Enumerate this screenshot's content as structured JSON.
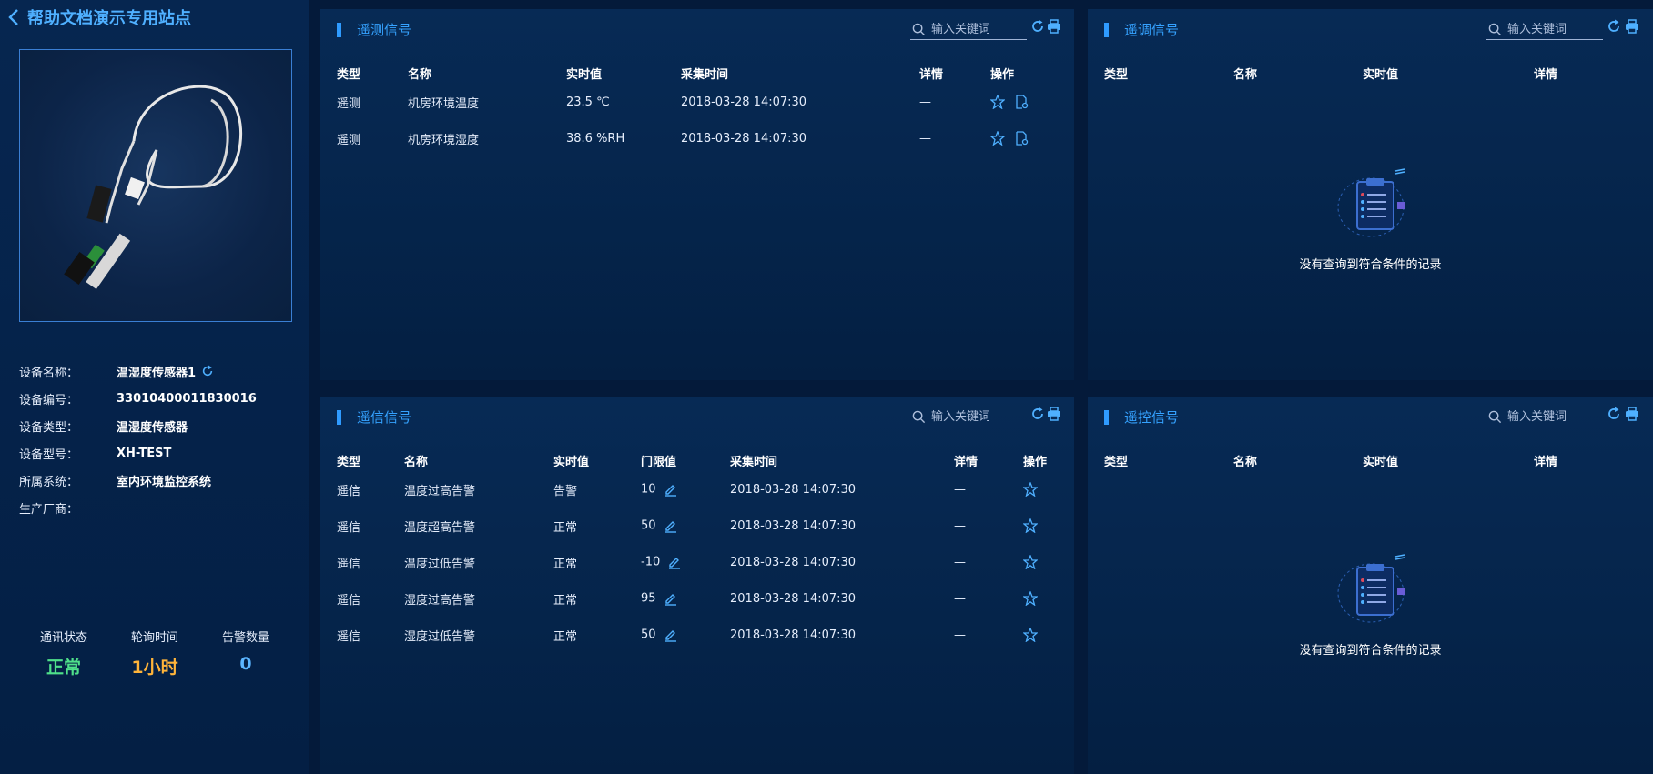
{
  "header": {
    "title": "帮助文档演示专用站点"
  },
  "device": {
    "fields": [
      {
        "label": "设备名称：",
        "value": "温湿度传感器1"
      },
      {
        "label": "设备编号：",
        "value": "33010400011830016"
      },
      {
        "label": "设备类型：",
        "value": "温湿度传感器"
      },
      {
        "label": "设备型号：",
        "value": "XH-TEST"
      },
      {
        "label": "所属系统：",
        "value": "室内环境监控系统"
      },
      {
        "label": "生产厂商：",
        "value": "—"
      }
    ],
    "stats": [
      {
        "label": "通讯状态",
        "value": "正常",
        "color": "#4fe08a"
      },
      {
        "label": "轮询时间",
        "value": "1小时",
        "color": "#ffb43a"
      },
      {
        "label": "告警数量",
        "value": "0",
        "color": "#5bb5ff"
      }
    ]
  },
  "search_placeholder": "输入关键词",
  "telemetry": {
    "title": "遥测信号",
    "columns": [
      "类型",
      "名称",
      "实时值",
      "采集时间",
      "详情",
      "操作"
    ],
    "rows": [
      {
        "type": "遥测",
        "name": "机房环境温度",
        "value": "23.5 ℃",
        "time": "2018-03-28 14:07:30",
        "detail": "—"
      },
      {
        "type": "遥测",
        "name": "机房环境湿度",
        "value": "38.6 %RH",
        "time": "2018-03-28 14:07:30",
        "detail": "—"
      }
    ]
  },
  "adjust": {
    "title": "遥调信号",
    "columns": [
      "类型",
      "名称",
      "实时值",
      "详情"
    ],
    "empty_text": "没有查询到符合条件的记录"
  },
  "signal": {
    "title": "遥信信号",
    "columns": [
      "类型",
      "名称",
      "实时值",
      "门限值",
      "采集时间",
      "详情",
      "操作"
    ],
    "rows": [
      {
        "type": "遥信",
        "name": "温度过高告警",
        "value": "告警",
        "threshold": "10",
        "time": "2018-03-28 14:07:30",
        "detail": "—"
      },
      {
        "type": "遥信",
        "name": "温度超高告警",
        "value": "正常",
        "threshold": "50",
        "time": "2018-03-28 14:07:30",
        "detail": "—"
      },
      {
        "type": "遥信",
        "name": "温度过低告警",
        "value": "正常",
        "threshold": "-10",
        "time": "2018-03-28 14:07:30",
        "detail": "—"
      },
      {
        "type": "遥信",
        "name": "湿度过高告警",
        "value": "正常",
        "threshold": "95",
        "time": "2018-03-28 14:07:30",
        "detail": "—"
      },
      {
        "type": "遥信",
        "name": "湿度过低告警",
        "value": "正常",
        "threshold": "50",
        "time": "2018-03-28 14:07:30",
        "detail": "—"
      }
    ]
  },
  "control": {
    "title": "遥控信号",
    "columns": [
      "类型",
      "名称",
      "实时值",
      "详情"
    ],
    "empty_text": "没有查询到符合条件的记录"
  },
  "colors": {
    "accent": "#35a2ff",
    "alarm": "#ff5c6c",
    "normal": "#4fe08a",
    "background": "#041a3a"
  }
}
